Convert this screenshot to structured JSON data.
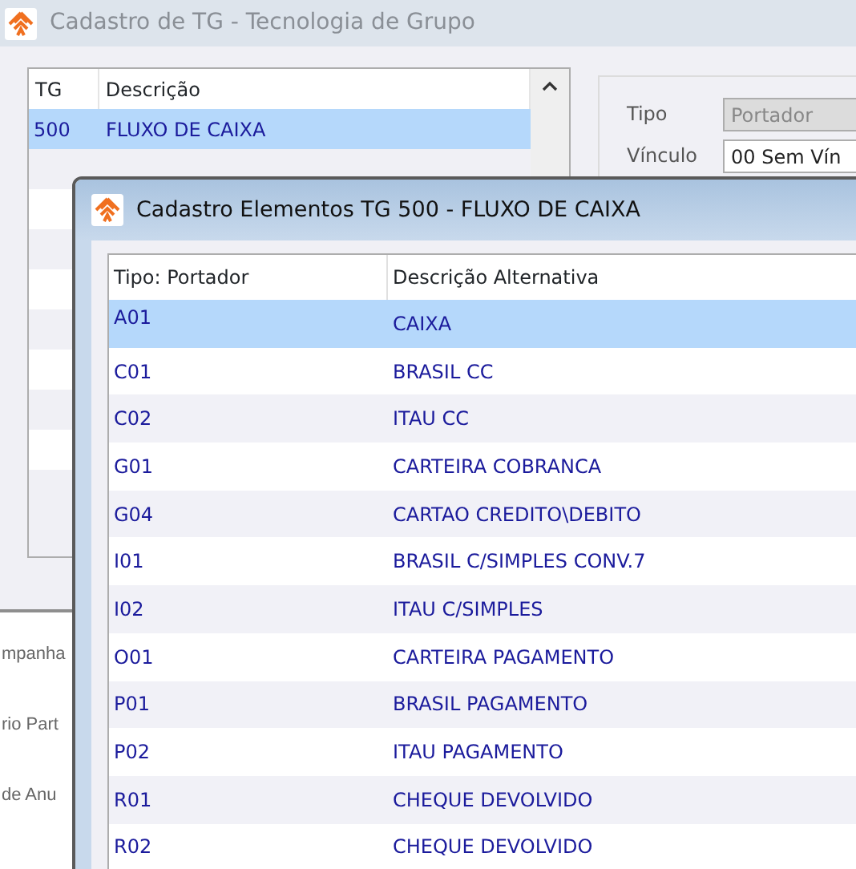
{
  "window": {
    "title": "Cadastro de TG - Tecnologia de Grupo"
  },
  "tg_list": {
    "columns": [
      "TG",
      "Descrição"
    ],
    "rows": [
      {
        "tg": "500",
        "descricao": "FLUXO DE CAIXA",
        "selected": true
      }
    ]
  },
  "form": {
    "fields": [
      {
        "label": "Tipo",
        "value": "Portador",
        "disabled": true
      },
      {
        "label": "Vínculo",
        "value": "00 Sem Vín",
        "disabled": false
      }
    ]
  },
  "side_labels": [
    "mpanha",
    "rio Part",
    "de Anu"
  ],
  "dialog": {
    "title": "Cadastro Elementos TG 500 - FLUXO DE CAIXA",
    "columns": [
      "Tipo: Portador",
      "Descrição Alternativa"
    ],
    "rows": [
      {
        "code": "A01",
        "description": "CAIXA",
        "selected": true
      },
      {
        "code": "C01",
        "description": "BRASIL CC",
        "selected": false
      },
      {
        "code": "C02",
        "description": "ITAU CC",
        "selected": false
      },
      {
        "code": "G01",
        "description": "CARTEIRA COBRANCA",
        "selected": false
      },
      {
        "code": "G04",
        "description": "CARTAO CREDITO\\DEBITO",
        "selected": false
      },
      {
        "code": "I01",
        "description": "BRASIL C/SIMPLES CONV.7",
        "selected": false
      },
      {
        "code": "I02",
        "description": "ITAU C/SIMPLES",
        "selected": false
      },
      {
        "code": "O01",
        "description": "CARTEIRA PAGAMENTO",
        "selected": false
      },
      {
        "code": "P01",
        "description": "BRASIL PAGAMENTO",
        "selected": false
      },
      {
        "code": "P02",
        "description": "ITAU PAGAMENTO",
        "selected": false
      },
      {
        "code": "R01",
        "description": "CHEQUE DEVOLVIDO",
        "selected": false
      },
      {
        "code": "R02",
        "description": "CHEQUE DEVOLVIDO",
        "selected": false
      }
    ]
  }
}
